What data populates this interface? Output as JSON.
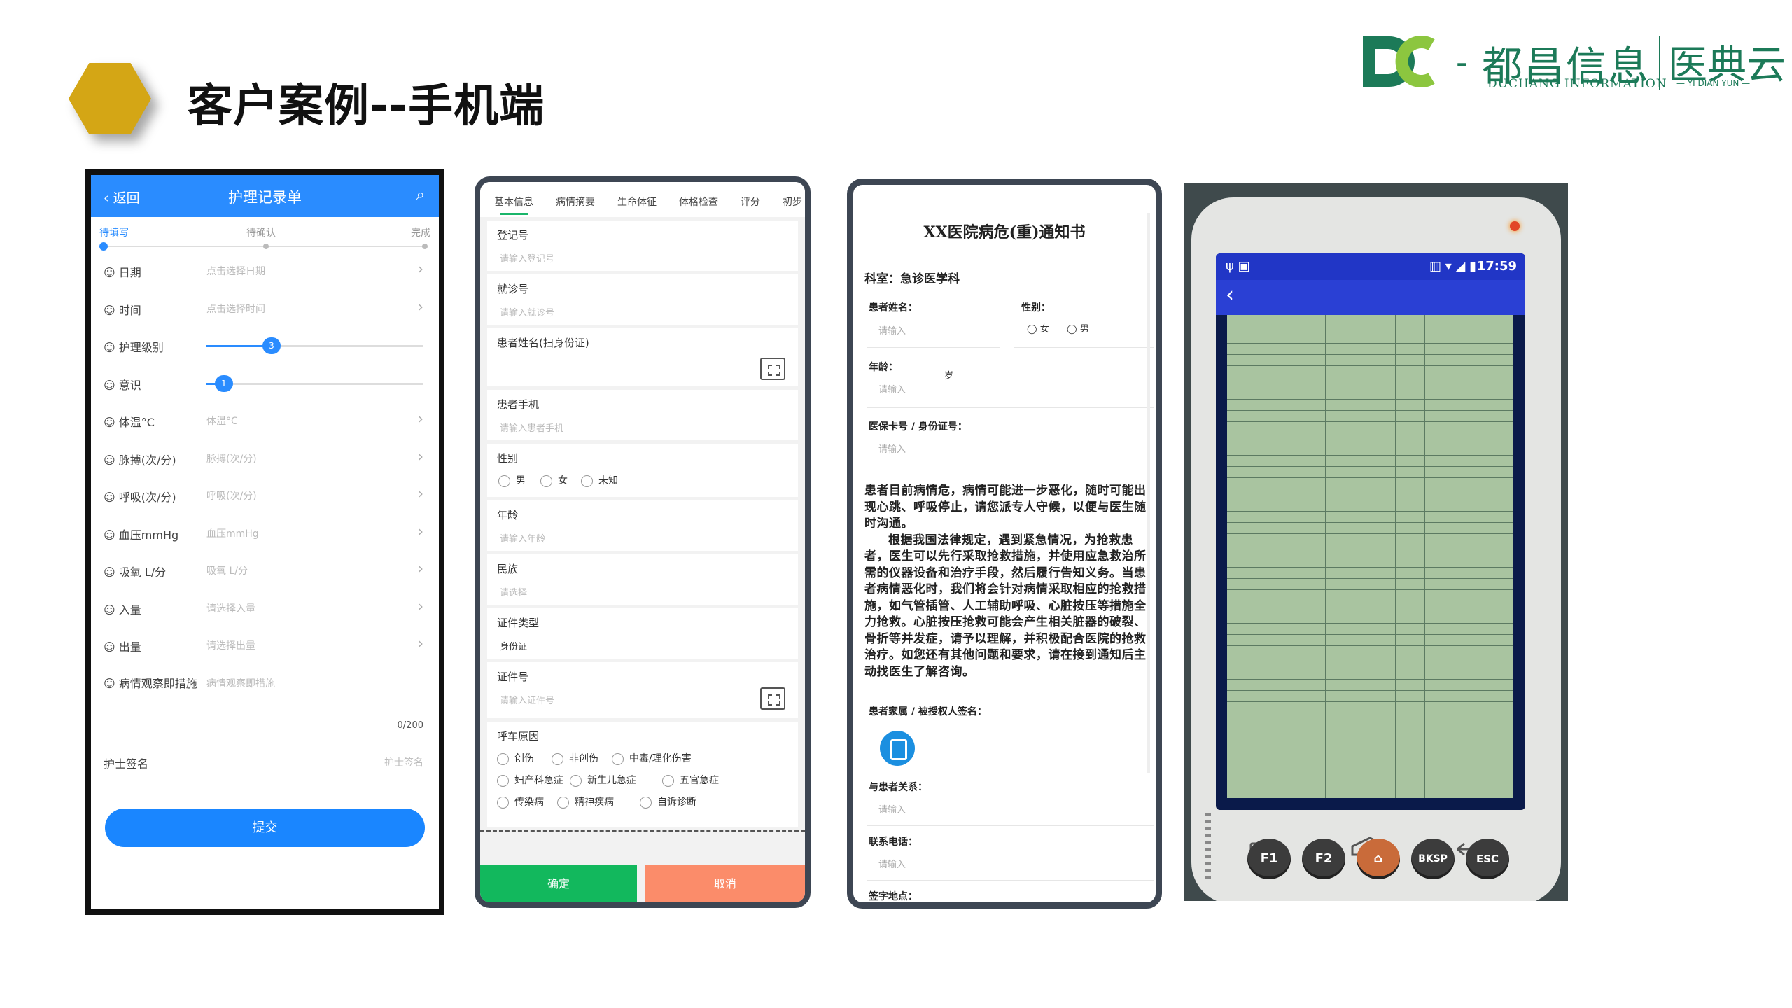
{
  "slide": {
    "title": "客户案例--手机端",
    "logo_cn": "都昌信息",
    "logo_en": "DUCHANG INFORMATION",
    "logo_cn2": "医典云",
    "logo_en2": "— YI DIAN YUN —",
    "accent_color": "#d4a615",
    "brand_color": "#1c7a58"
  },
  "screen1": {
    "back": "返回",
    "title": "护理记录单",
    "steps": [
      "待填写",
      "待确认",
      "完成"
    ],
    "rows": [
      {
        "label": "日期",
        "placeholder": "点击选择日期"
      },
      {
        "label": "时间",
        "placeholder": "点击选择时间"
      },
      {
        "label": "护理级别",
        "slider_value": "3"
      },
      {
        "label": "意识",
        "slider_value": "1"
      },
      {
        "label": "体温°C",
        "placeholder": "体温°C"
      },
      {
        "label": "脉搏(次/分)",
        "placeholder": "脉搏(次/分)"
      },
      {
        "label": "呼吸(次/分)",
        "placeholder": "呼吸(次/分)"
      },
      {
        "label": "血压mmHg",
        "placeholder": "血压mmHg"
      },
      {
        "label": "吸氧 L/分",
        "placeholder": "吸氧 L/分"
      },
      {
        "label": "入量",
        "placeholder": "请选择入量"
      },
      {
        "label": "出量",
        "placeholder": "请选择出量"
      }
    ],
    "observe_label": "病情观察即措施",
    "observe_placeholder": "病情观察即措施",
    "counter": "0/200",
    "nurse_label": "护士签名",
    "nurse_placeholder": "护士签名",
    "submit": "提交",
    "primary_color": "#2a8cff"
  },
  "screen2": {
    "tabs": [
      "基本信息",
      "病情摘要",
      "生命体征",
      "体格检查",
      "评分",
      "初步"
    ],
    "fields": [
      {
        "label": "登记号",
        "placeholder": "请输入登记号"
      },
      {
        "label": "就诊号",
        "placeholder": "请输入就诊号"
      },
      {
        "label": "患者姓名(扫身份证)",
        "placeholder": ""
      },
      {
        "label": "患者手机",
        "placeholder": "请输入患者手机"
      },
      {
        "label": "性别",
        "placeholder": ""
      },
      {
        "label": "年龄",
        "placeholder": "请输入年龄"
      },
      {
        "label": "民族",
        "placeholder": "请选择"
      },
      {
        "label": "证件类型",
        "value": "身份证"
      },
      {
        "label": "证件号",
        "placeholder": "请输入证件号"
      },
      {
        "label": "呼车原因",
        "placeholder": ""
      }
    ],
    "gender_options": [
      "男",
      "女",
      "未知"
    ],
    "reasons": [
      "创伤",
      "非创伤",
      "中毒/理化伤害",
      "妇产科急症",
      "新生儿急症",
      "五官急症",
      "传染病",
      "精神疾病",
      "自诉诊断"
    ],
    "ok": "确定",
    "cancel": "取消",
    "ok_color": "#12b85d",
    "cancel_color": "#fb8c6a"
  },
  "screen3": {
    "title": "XX医院病危(重)通知书",
    "dept": "科室：急诊医学科",
    "patient_name_label": "患者姓名：",
    "gender_label": "性别：",
    "gender_options": [
      "女",
      "男"
    ],
    "age_label": "年龄：",
    "age_unit": "岁",
    "id_label": "医保卡号 / 身份证号：",
    "placeholder": "请输入",
    "paragraph1": "患者目前病情危，病情可能进一步恶化，随时可能出现心跳、呼吸停止，请您派专人守候，以便与医生随时沟通。",
    "paragraph2": "根据我国法律规定，遇到紧急情况，为抢救患者，医生可以先行采取抢救措施，并使用应急救治所需的仪器设备和治疗手段，然后履行告知义务。当患者病情恶化时，我们将会针对病情采取相应的抢救措施，如气管插管、人工辅助呼吸、心脏按压等措施全力抢救。心脏按压抢救可能会产生相关脏器的破裂、骨折等并发症，请予以理解，并积极配合医院的抢救治疗。如您还有其他问题和要求，请在接到通知后主动找医生了解咨询。",
    "signer_label": "患者家属 / 被授权人签名：",
    "relation_label": "与患者关系：",
    "phone_label": "联系电话：",
    "place_label": "签字地点："
  },
  "screen4": {
    "time": "17:59",
    "keys": [
      "F1",
      "F2",
      "⌂",
      "BKSP",
      "ESC"
    ]
  }
}
